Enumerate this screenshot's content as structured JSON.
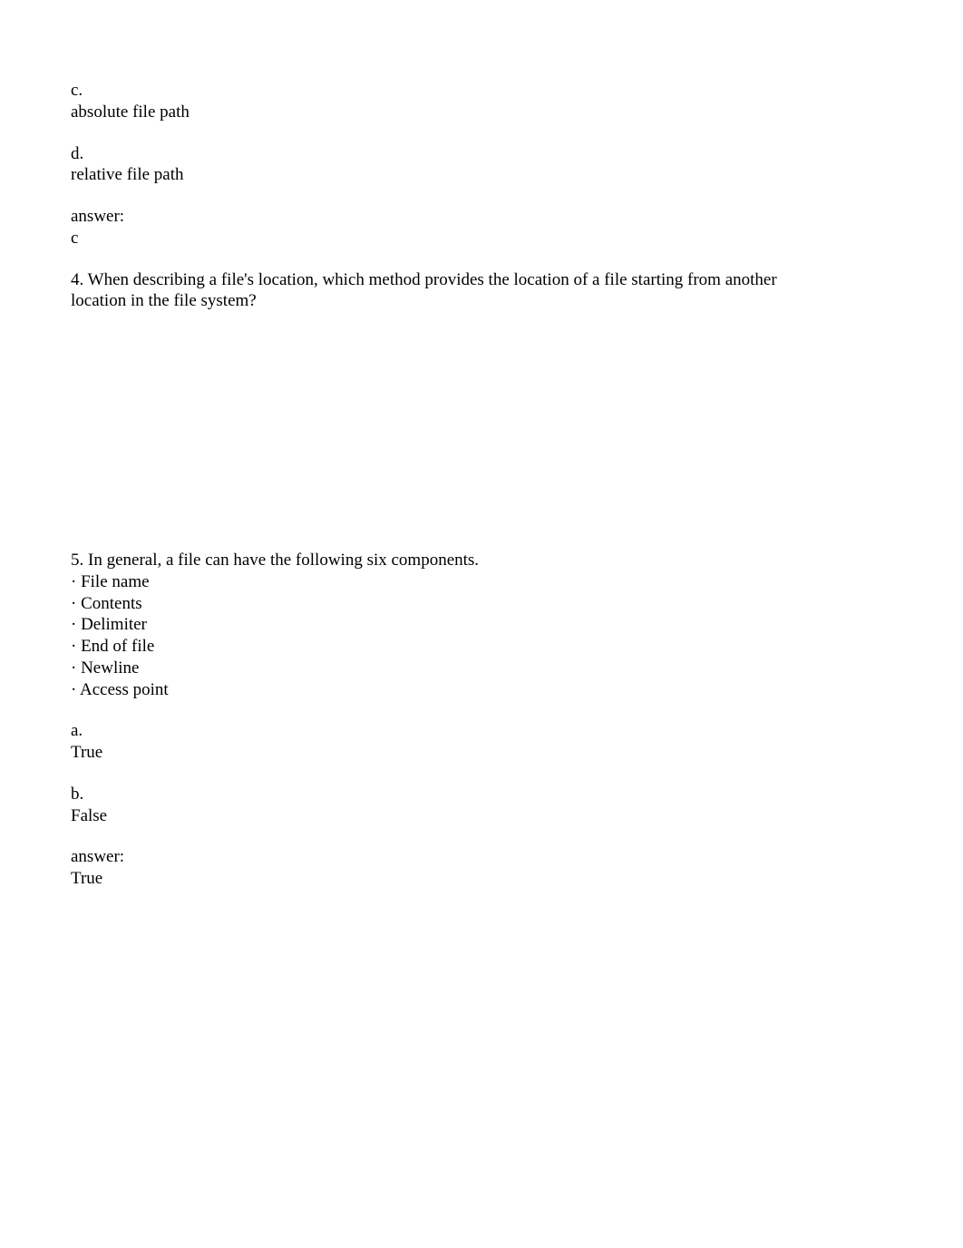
{
  "options_c": {
    "letter": "c.",
    "text": "absolute file path"
  },
  "options_d": {
    "letter": "d.",
    "text": "relative file path"
  },
  "answer_section_1": {
    "label": "answer:",
    "value": "c"
  },
  "question_4": {
    "text_line_1": "4. When describing a file's location, which method provides the location of a file starting from another",
    "text_line_2": "location in the file system?"
  },
  "question_5": {
    "intro": "5. In general, a file can have the following six components.",
    "bullets": [
      "· File name",
      "· Contents",
      "· Delimiter",
      "· End of file",
      "· Newline",
      "· Access point"
    ],
    "option_a": {
      "letter": "a.",
      "text": "True"
    },
    "option_b": {
      "letter": "b.",
      "text": "False"
    },
    "answer": {
      "label": "answer:",
      "value": "True"
    }
  }
}
